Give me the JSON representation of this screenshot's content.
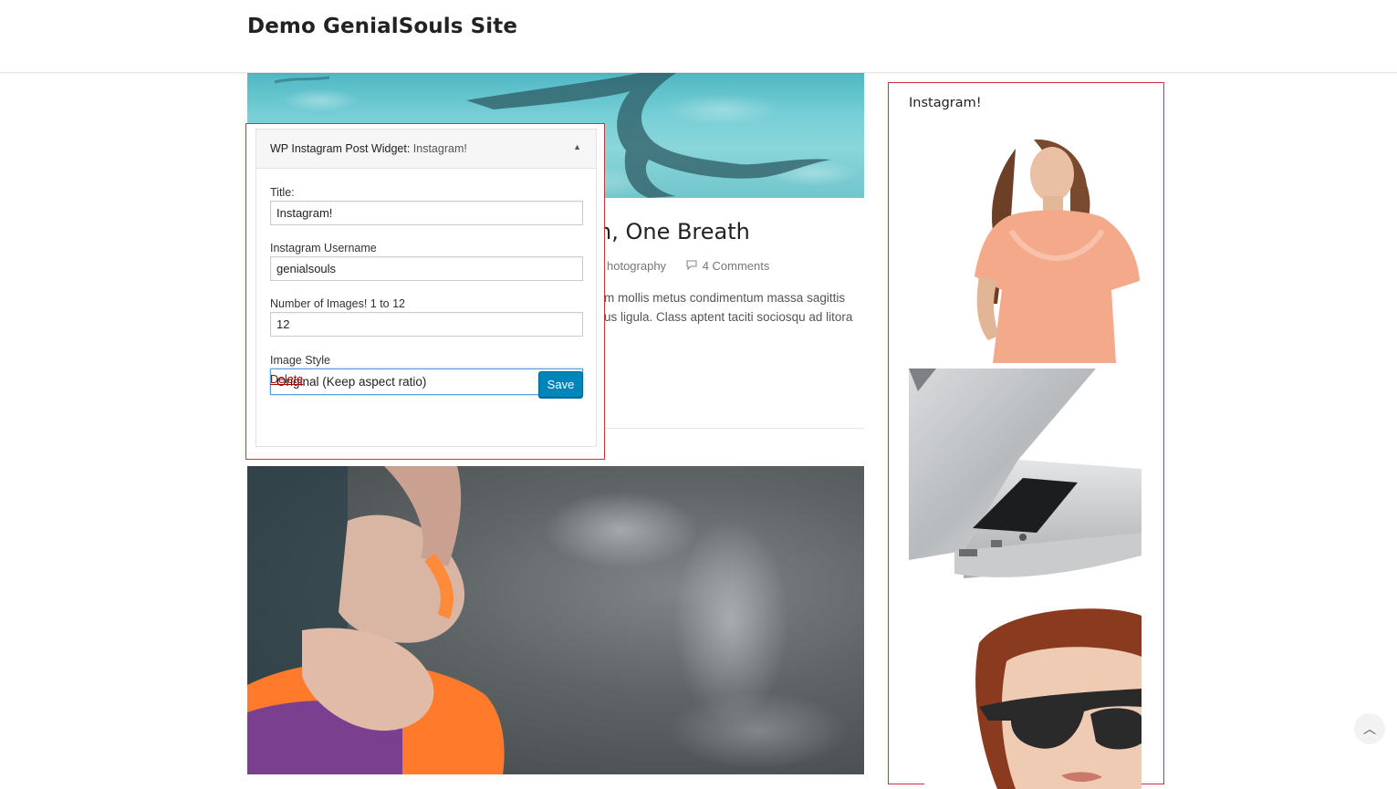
{
  "site": {
    "title": "Demo GenialSouls Site"
  },
  "post": {
    "title_partial": "n, One Breath",
    "category_partial": "hotography",
    "comments": "4 Comments",
    "excerpt_line1": "m mollis metus condimentum massa sagittis",
    "excerpt_line2": "us ligula. Class aptent taciti sociosqu ad litora"
  },
  "widget": {
    "name": "WP Instagram Post Widget:",
    "title_display": "Instagram!",
    "toggle": "▲",
    "fields": {
      "title_label": "Title:",
      "title_value": "Instagram!",
      "username_label": "Instagram Username",
      "username_value": "genialsouls",
      "count_label": "Number of Images! 1 to 12",
      "count_value": "12",
      "style_label": "Image Style",
      "style_value": "Original (Keep aspect ratio)",
      "style_arrow": "▼"
    },
    "delete_label": "Delete",
    "save_label": "Save"
  },
  "sidebar": {
    "widget_title": "Instagram!",
    "images": [
      "woman-peach-blouse",
      "laptop-closeup",
      "woman-sunglasses"
    ]
  },
  "back_to_top": "︿",
  "colors": {
    "accent_red": "#c9353f",
    "save_blue": "#0085ba",
    "delete_red": "#aa0000"
  }
}
